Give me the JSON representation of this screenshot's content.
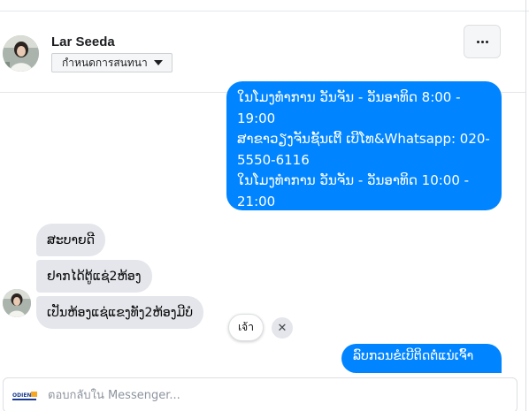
{
  "header": {
    "contact_name": "Lar Seeda",
    "define_conversation_label": "กำหนดการสนทนา",
    "more_label": "···"
  },
  "messages": {
    "outgoing_hours": "ໃນໂມງທຳການ ວັນຈັນ - ວັນອາທິດ  8:00 -\n19:00\nສາຂາວຽງຈັນຊັ້ນເຕີ້ ເບີໂທ&Whatsapp: 020-\n5550-6116\nໃນໂມງທຳການ ວັນຈັນ - ວັນອາທິດ  10:00 -\n21:00",
    "incoming_1": "ສະບາຍດີ",
    "incoming_2": "ຢາກໄດ້ຕູ້ແຊ່2ຫ້ອງ",
    "incoming_3": "ເປັນຫ້ອງແຊ່ແຂງທັງ2ຫ້ອງມີບໍ",
    "outgoing_reply": "ລົບກວນຂໍເບີຕິດຕໍ່ແນ່ເຈົ້າ"
  },
  "quick_reply": {
    "chip_label": "เจ้า",
    "close_label": "✕"
  },
  "composer": {
    "placeholder": "ตอบกลับใน Messenger...",
    "logo_text": "ODIEN"
  },
  "colors": {
    "outgoing_bubble": "#0084ff",
    "incoming_bubble": "#e4e6eb"
  }
}
